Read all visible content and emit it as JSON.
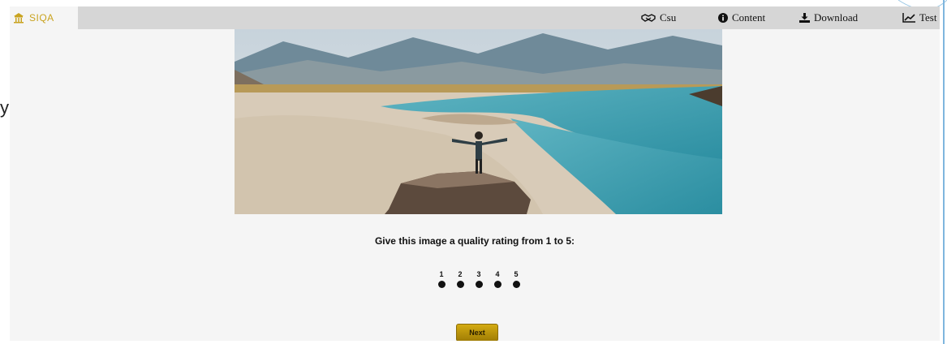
{
  "brand": {
    "name": "SIQA",
    "logo_icon": "temple-icon",
    "color": "#c9a31f"
  },
  "nav": [
    {
      "label": "Csu",
      "icon": "handshake-icon"
    },
    {
      "label": "Content",
      "icon": "info-icon"
    },
    {
      "label": "Download",
      "icon": "download-icon"
    },
    {
      "label": "Test",
      "icon": "line-chart-icon"
    }
  ],
  "side_fragment": "y",
  "main": {
    "prompt": "Give this image a quality rating from 1 to 5:",
    "rating_options": [
      "1",
      "2",
      "3",
      "4",
      "5"
    ],
    "next_label": "Next"
  },
  "colors": {
    "topbar": "#d6d6d6",
    "accent_button": "#c49a0c",
    "background": "#f5f5f5"
  }
}
